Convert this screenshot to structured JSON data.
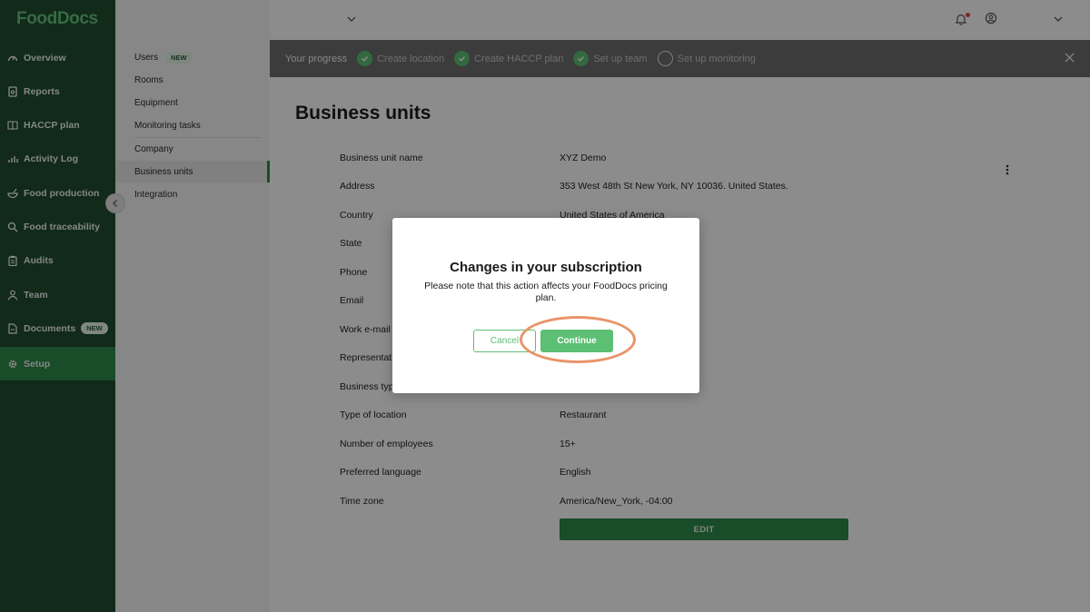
{
  "app": {
    "logo": "FoodDocs"
  },
  "sidebar": {
    "items": [
      {
        "label": "Overview",
        "icon": "gauge-icon"
      },
      {
        "label": "Reports",
        "icon": "report-icon"
      },
      {
        "label": "HACCP plan",
        "icon": "book-icon"
      },
      {
        "label": "Activity Log",
        "icon": "bar-chart-icon"
      },
      {
        "label": "Food production",
        "icon": "bowl-icon"
      },
      {
        "label": "Food traceability",
        "icon": "search-icon"
      },
      {
        "label": "Audits",
        "icon": "clipboard-icon"
      },
      {
        "label": "Team",
        "icon": "person-icon"
      },
      {
        "label": "Documents",
        "icon": "document-icon",
        "badge": "NEW"
      },
      {
        "label": "Setup",
        "icon": "gear-icon",
        "active": true
      }
    ]
  },
  "subnav": {
    "items": [
      {
        "label": "Users",
        "badge": "NEW"
      },
      {
        "label": "Rooms"
      },
      {
        "label": "Equipment"
      },
      {
        "label": "Monitoring tasks"
      },
      {
        "label": "Company"
      },
      {
        "label": "Business units",
        "active": true
      },
      {
        "label": "Integration"
      }
    ]
  },
  "progress": {
    "title": "Your progress",
    "steps": [
      {
        "label": "Create location",
        "done": true
      },
      {
        "label": "Create HACCP plan",
        "done": true
      },
      {
        "label": "Set up team",
        "done": true
      },
      {
        "label": "Set up monitoring",
        "done": false
      }
    ]
  },
  "main": {
    "title": "Business units",
    "fields": [
      {
        "label": "Business unit name",
        "value": "XYZ Demo"
      },
      {
        "label": "Address",
        "value": "353 West 48th St New York, NY 10036. United States."
      },
      {
        "label": "Country",
        "value": "United States of America"
      },
      {
        "label": "State",
        "value": ""
      },
      {
        "label": "Phone",
        "value": ""
      },
      {
        "label": "Email",
        "value": ""
      },
      {
        "label": "Work e-mail",
        "value": ""
      },
      {
        "label": "Representative",
        "value": ""
      },
      {
        "label": "Business type",
        "value": ""
      },
      {
        "label": "Type of location",
        "value": "Restaurant"
      },
      {
        "label": "Number of employees",
        "value": "15+"
      },
      {
        "label": "Preferred language",
        "value": "English"
      },
      {
        "label": "Time zone",
        "value": "America/New_York, -04:00"
      }
    ],
    "edit_label": "EDIT"
  },
  "modal": {
    "title": "Changes in your subscription",
    "text": "Please note that this action affects your FoodDocs pricing plan.",
    "cancel_label": "Cancel",
    "continue_label": "Continue"
  },
  "colors": {
    "nav_bg": "#1f4d2f",
    "accent": "#5cbf73",
    "active_nav": "#2e8b4b",
    "highlight_ring": "#e9946a"
  }
}
